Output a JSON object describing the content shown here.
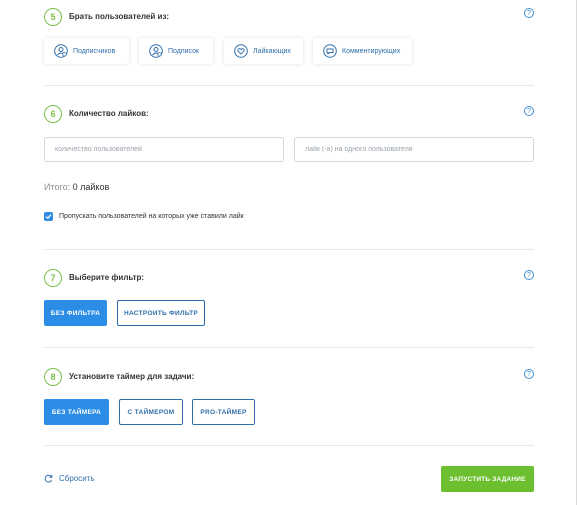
{
  "colors": {
    "accent": "#2b8de6",
    "step": "#7cc04a",
    "launch": "#6cbf2f",
    "link": "#2f6eaa"
  },
  "section5": {
    "number": "5",
    "title": "Брать пользователей из:",
    "help": "?",
    "sources": [
      {
        "label": "Подписчиков",
        "icon": "followers-icon"
      },
      {
        "label": "Подписок",
        "icon": "following-icon"
      },
      {
        "label": "Лайкающих",
        "icon": "heart-icon"
      },
      {
        "label": "Комментирующих",
        "icon": "comment-icon"
      }
    ]
  },
  "section6": {
    "number": "6",
    "title": "Количество лайков:",
    "help": "?",
    "users_placeholder": "количество пользователей",
    "likes_placeholder": "лайк (-а) на одного пользователя",
    "total_label": "Итого:",
    "total_value": "0 лайков",
    "skip_checkbox": {
      "label": "Пропускать пользователей на которых уже ставили лайк",
      "checked": true
    }
  },
  "section7": {
    "number": "7",
    "title": "Выберите фильтр:",
    "help": "?",
    "no_filter": "БЕЗ ФИЛЬТРА",
    "configure": "НАСТРОИТЬ ФИЛЬТР"
  },
  "section8": {
    "number": "8",
    "title": "Установите таймер для задачи:",
    "help": "?",
    "no_timer": "БЕЗ ТАЙМЕРА",
    "with_timer": "С ТАЙМЕРОМ",
    "pro_timer": "PRO-ТАЙМЕР"
  },
  "footer": {
    "reset": "Сбросить",
    "launch": "ЗАПУСТИТЬ ЗАДАНИЕ"
  }
}
